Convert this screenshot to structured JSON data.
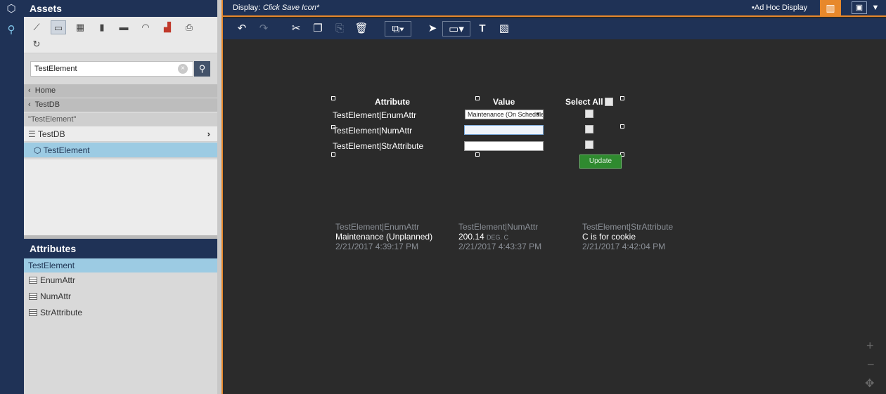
{
  "assets": {
    "title": "Assets",
    "toolbar_icons": [
      "trend-icon",
      "symbol-table-icon",
      "table-icon",
      "vertical-bar-icon",
      "horizontal-bar-icon",
      "gauge-icon",
      "bar-chart-icon",
      "print-icon",
      "refresh-icon"
    ],
    "search": {
      "value": "TestElement",
      "placeholder": ""
    },
    "breadcrumbs": [
      {
        "label": "Home"
      },
      {
        "label": "TestDB"
      }
    ],
    "search_scope": "\"TestElement\"",
    "tree": [
      {
        "label": "TestDB",
        "icon": "database-icon"
      },
      {
        "label": "TestElement",
        "icon": "element-cube-icon"
      }
    ]
  },
  "attributes": {
    "title": "Attributes",
    "selected_element": "TestElement",
    "items": [
      {
        "label": "EnumAttr"
      },
      {
        "label": "NumAttr"
      },
      {
        "label": "StrAttribute"
      }
    ]
  },
  "display": {
    "label": "Display:",
    "name": "Click Save Icon*",
    "ad_hoc_label": "Ad Hoc Display",
    "accent_color": "#e7882b",
    "header_color": "#1f3256"
  },
  "draw_toolbar": [
    "undo-icon",
    "redo-icon",
    "cut-icon",
    "copy-icon",
    "paste-icon",
    "delete-icon",
    "arrange-icon",
    "select-arrow-icon",
    "rectangle-icon",
    "text-tool-icon",
    "image-tool-icon"
  ],
  "symbol_table": {
    "headers": {
      "attribute": "Attribute",
      "value": "Value",
      "select_all": "Select All"
    },
    "rows": [
      {
        "attribute": "TestElement|EnumAttr",
        "value": "Maintenance (On Schedule)"
      },
      {
        "attribute": "TestElement|NumAttr",
        "value": ""
      },
      {
        "attribute": "TestElement|StrAttribute",
        "value": ""
      }
    ],
    "update_label": "Update"
  },
  "value_symbols": [
    {
      "name": "TestElement|EnumAttr",
      "value": "Maintenance (Unplanned)",
      "unit": "",
      "time": "2/21/2017 4:39:17 PM"
    },
    {
      "name": "TestElement|NumAttr",
      "value": "200.14",
      "unit": "DEG. C",
      "time": "2/21/2017 4:43:37 PM"
    },
    {
      "name": "TestElement|StrAttribute",
      "value": "C is for cookie",
      "unit": "",
      "time": "2/21/2017 4:42:04 PM"
    }
  ]
}
